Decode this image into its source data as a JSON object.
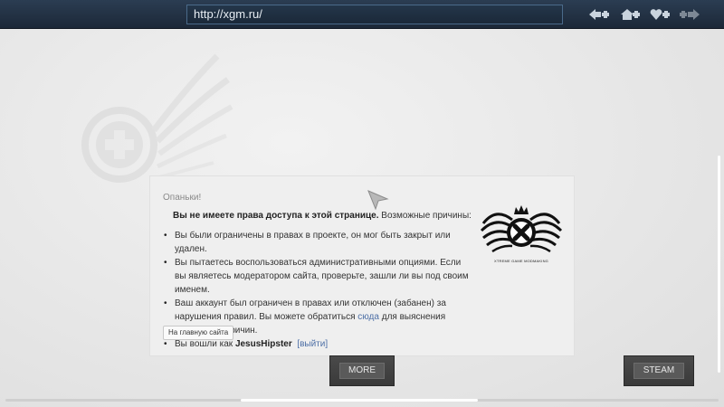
{
  "browser": {
    "url": "http://xgm.ru/",
    "nav_icons": [
      "back-icon",
      "home-icon",
      "favorites-icon",
      "forward-icon"
    ]
  },
  "dialog": {
    "oops": "Опаньки!",
    "headline_bold": "Вы не имеете права доступа к этой странице.",
    "headline_rest": " Возможные причины:",
    "reasons": {
      "r1": "Вы были ограничены в правах в проекте, он мог быть закрыт или удален.",
      "r2": "Вы пытаетесь воспользоваться административными опциями. Если вы являетесь модератором сайта, проверьте, зашли ли вы под своим именем.",
      "r3_before": "Ваш аккаунт был ограничен в правах или отключен (забанен) за нарушения правил. Вы можете обратиться ",
      "r3_link": "сюда",
      "r3_after": " для выяснения конкретных причин.",
      "r4_before": "Вы вошли как ",
      "r4_user": "JesusHipster",
      "r4_logout": "[выйти]"
    },
    "home_button": "На главную сайта",
    "logo_caption": "XTREME GAME MODMAKING"
  },
  "buttons": {
    "more": "MORE",
    "steam": "STEAM"
  },
  "colors": {
    "topbar": "#1f2d3f",
    "background": "#e9e9e9",
    "link": "#4d6fa6"
  }
}
